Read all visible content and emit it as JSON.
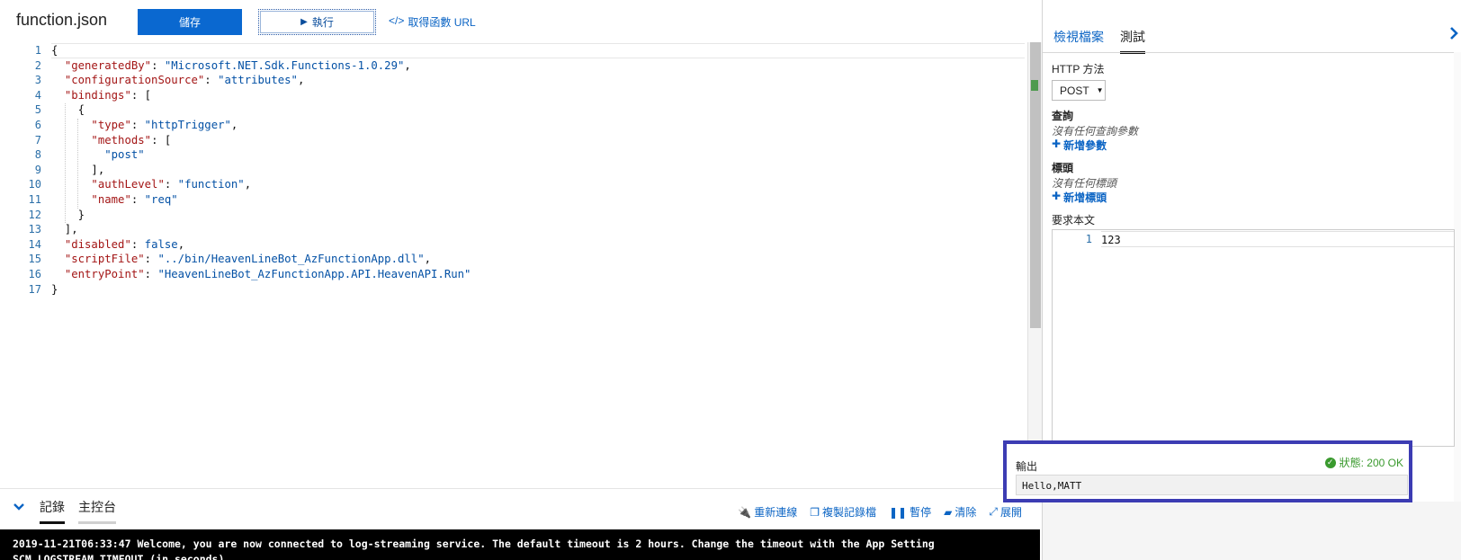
{
  "toolbar": {
    "file_title": "function.json",
    "save_label": "儲存",
    "run_label": "執行",
    "get_url_code": "</>",
    "get_url_label": "取得函數 URL"
  },
  "editor": {
    "line_numbers": [
      "1",
      "2",
      "3",
      "4",
      "5",
      "6",
      "7",
      "8",
      "9",
      "10",
      "11",
      "12",
      "13",
      "14",
      "15",
      "16",
      "17"
    ],
    "lines": [
      [
        {
          "t": "p",
          "v": "{"
        }
      ],
      [
        {
          "t": "p",
          "v": "  "
        },
        {
          "t": "key",
          "v": "\"generatedBy\""
        },
        {
          "t": "p",
          "v": ": "
        },
        {
          "t": "str",
          "v": "\"Microsoft.NET.Sdk.Functions-1.0.29\""
        },
        {
          "t": "p",
          "v": ","
        }
      ],
      [
        {
          "t": "p",
          "v": "  "
        },
        {
          "t": "key",
          "v": "\"configurationSource\""
        },
        {
          "t": "p",
          "v": ": "
        },
        {
          "t": "str",
          "v": "\"attributes\""
        },
        {
          "t": "p",
          "v": ","
        }
      ],
      [
        {
          "t": "p",
          "v": "  "
        },
        {
          "t": "key",
          "v": "\"bindings\""
        },
        {
          "t": "p",
          "v": ": ["
        }
      ],
      [
        {
          "t": "p",
          "v": "    {"
        }
      ],
      [
        {
          "t": "p",
          "v": "      "
        },
        {
          "t": "key",
          "v": "\"type\""
        },
        {
          "t": "p",
          "v": ": "
        },
        {
          "t": "str",
          "v": "\"httpTrigger\""
        },
        {
          "t": "p",
          "v": ","
        }
      ],
      [
        {
          "t": "p",
          "v": "      "
        },
        {
          "t": "key",
          "v": "\"methods\""
        },
        {
          "t": "p",
          "v": ": ["
        }
      ],
      [
        {
          "t": "p",
          "v": "        "
        },
        {
          "t": "str",
          "v": "\"post\""
        }
      ],
      [
        {
          "t": "p",
          "v": "      ],"
        }
      ],
      [
        {
          "t": "p",
          "v": "      "
        },
        {
          "t": "key",
          "v": "\"authLevel\""
        },
        {
          "t": "p",
          "v": ": "
        },
        {
          "t": "str",
          "v": "\"function\""
        },
        {
          "t": "p",
          "v": ","
        }
      ],
      [
        {
          "t": "p",
          "v": "      "
        },
        {
          "t": "key",
          "v": "\"name\""
        },
        {
          "t": "p",
          "v": ": "
        },
        {
          "t": "str",
          "v": "\"req\""
        }
      ],
      [
        {
          "t": "p",
          "v": "    }"
        }
      ],
      [
        {
          "t": "p",
          "v": "  ],"
        }
      ],
      [
        {
          "t": "p",
          "v": "  "
        },
        {
          "t": "key",
          "v": "\"disabled\""
        },
        {
          "t": "p",
          "v": ": "
        },
        {
          "t": "kw",
          "v": "false"
        },
        {
          "t": "p",
          "v": ","
        }
      ],
      [
        {
          "t": "p",
          "v": "  "
        },
        {
          "t": "key",
          "v": "\"scriptFile\""
        },
        {
          "t": "p",
          "v": ": "
        },
        {
          "t": "str",
          "v": "\"../bin/HeavenLineBot_AzFunctionApp.dll\""
        },
        {
          "t": "p",
          "v": ","
        }
      ],
      [
        {
          "t": "p",
          "v": "  "
        },
        {
          "t": "key",
          "v": "\"entryPoint\""
        },
        {
          "t": "p",
          "v": ": "
        },
        {
          "t": "str",
          "v": "\"HeavenLineBot_AzFunctionApp.API.HeavenAPI.Run\""
        }
      ],
      [
        {
          "t": "p",
          "v": "}"
        }
      ]
    ]
  },
  "log_panel": {
    "tab_logs": "記錄",
    "tab_console": "主控台",
    "actions": {
      "reconnect": "重新連線",
      "copy_logs": "複製記錄檔",
      "pause": "暫停",
      "clear": "清除",
      "expand": "展開"
    },
    "log_line_1": "2019-11-21T06:33:47  Welcome, you are now connected to log-streaming service. The default timeout is 2 hours. Change the timeout with the App Setting",
    "log_line_2": "SCM_LOGSTREAM_TIMEOUT (in seconds)."
  },
  "right_pane": {
    "tab_view_files": "檢視檔案",
    "tab_test": "測試",
    "http_method_label": "HTTP 方法",
    "http_method_value": "POST",
    "query_label": "查詢",
    "no_query_params": "沒有任何查詢參數",
    "add_param": "新增參數",
    "headers_label": "標頭",
    "no_headers": "沒有任何標頭",
    "add_header": "新增標頭",
    "request_body_label": "要求本文",
    "request_body_line_number": "1",
    "request_body_value": "123",
    "output_label": "輸出",
    "status_text": "狀態: 200 OK",
    "output_value": "Hello,MATT"
  },
  "colors": {
    "accent": "#0a68d0",
    "link": "#0b64c4",
    "status_ok": "#3a9a2e",
    "highlight_box": "#3c3cb3"
  }
}
